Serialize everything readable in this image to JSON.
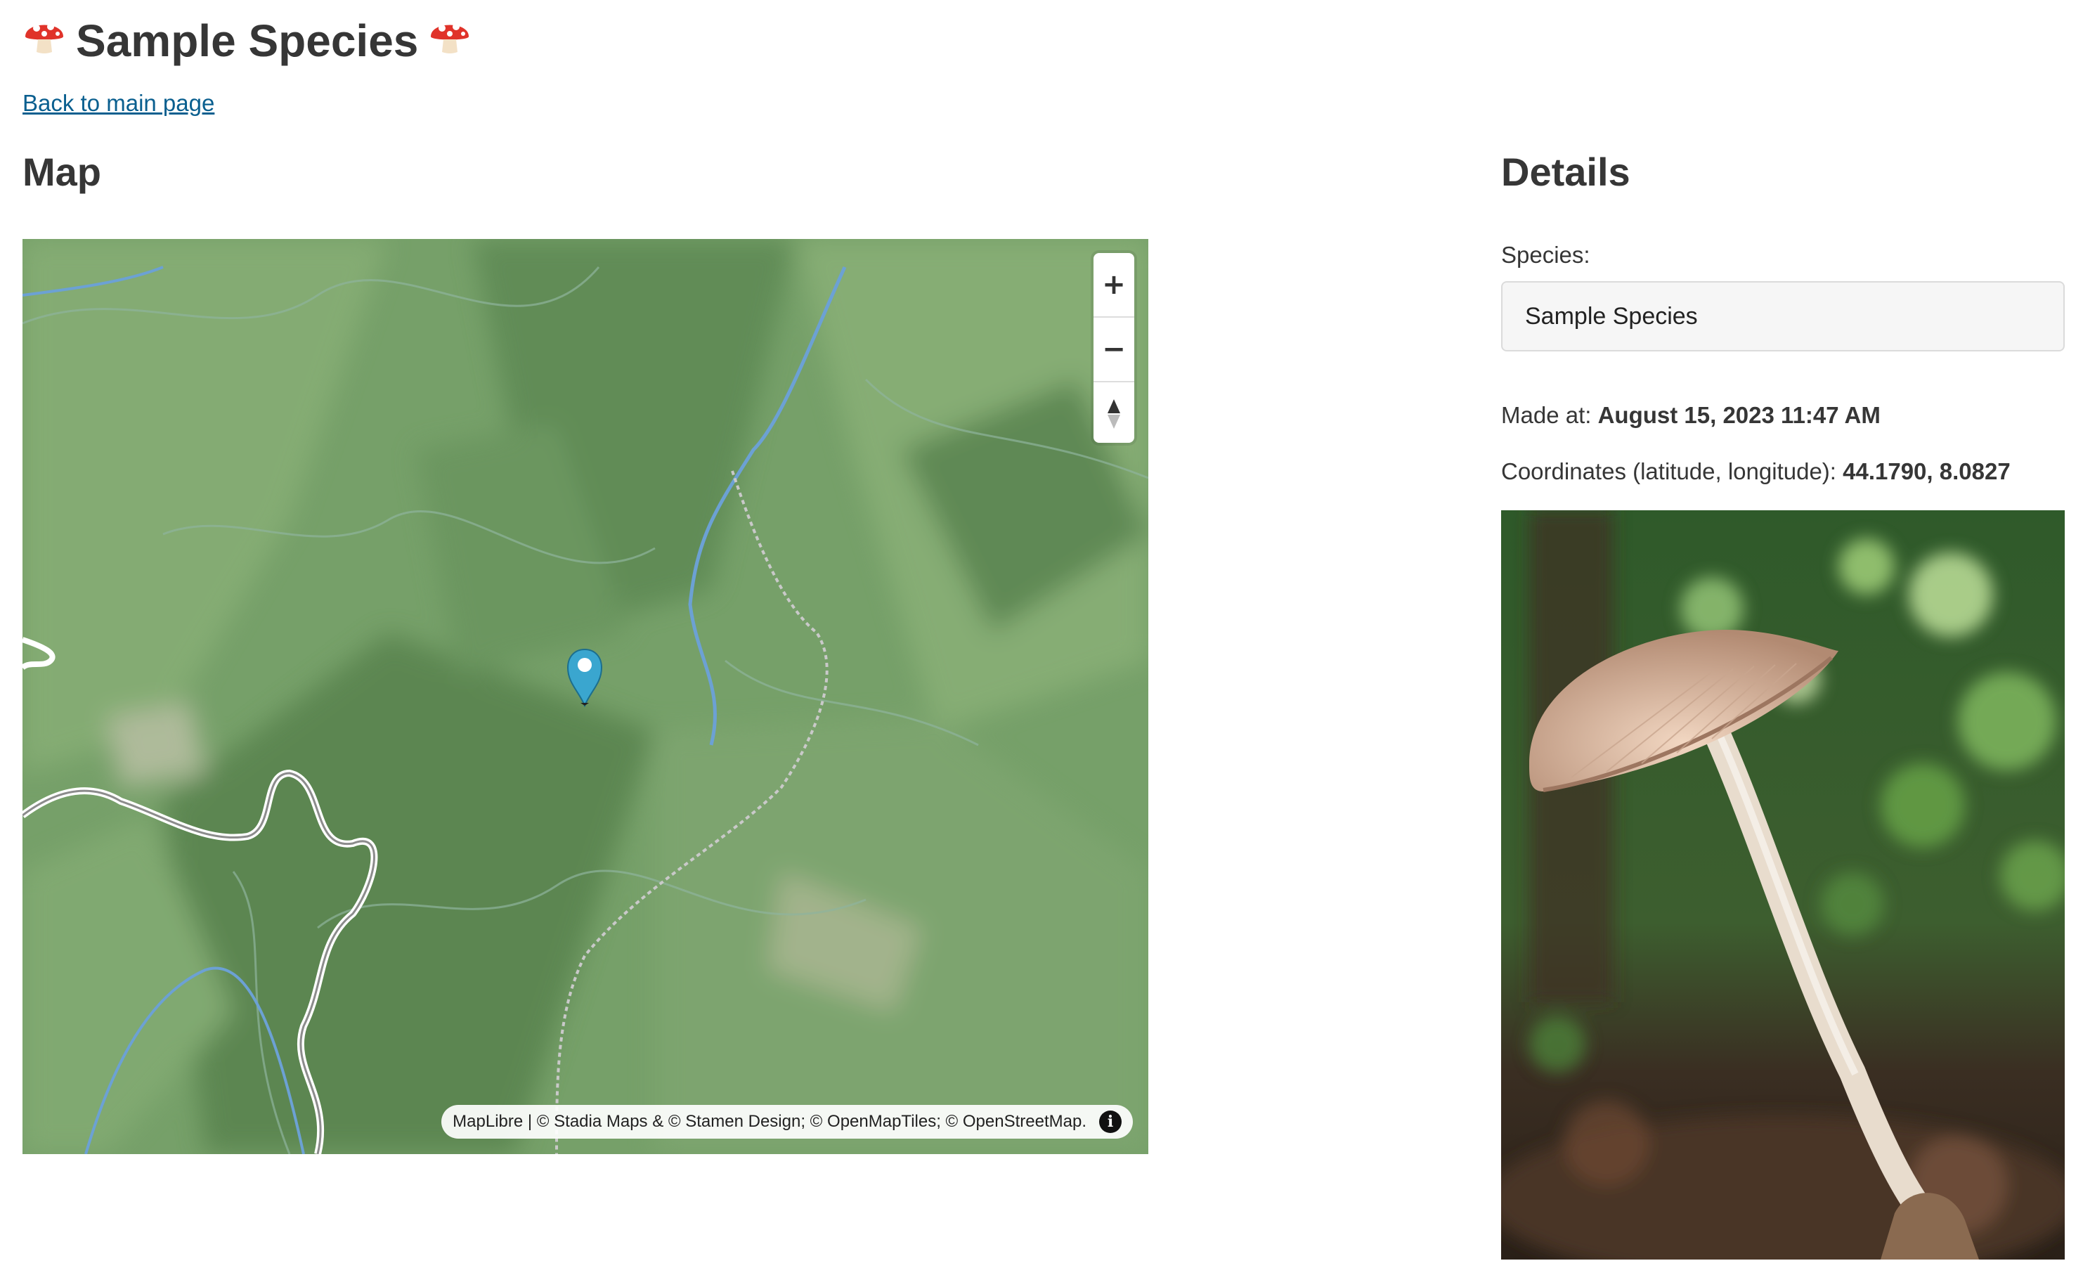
{
  "page": {
    "title": "Sample Species",
    "title_icon": "mushroom-emoji",
    "back_link": "Back to main page"
  },
  "map_section": {
    "heading": "Map",
    "controls": {
      "zoom_in": "+",
      "zoom_out": "−",
      "compass": "north-arrow-icon"
    },
    "marker_icon": "map-pin-icon",
    "attribution": "MapLibre | © Stadia Maps & © Stamen Design; © OpenMapTiles; © OpenStreetMap.",
    "info_icon": "i"
  },
  "details": {
    "heading": "Details",
    "species_label": "Species:",
    "species_value": "Sample Species",
    "made_at_label": "Made at:",
    "made_at_value": "August 15, 2023 11:47 AM",
    "coords_label": "Coordinates (latitude, longitude):",
    "coords_value": "44.1790, 8.0827",
    "photo": "mushroom-photo"
  },
  "colors": {
    "link": "#0a5f8f",
    "map_green": "#6f9a63",
    "marker": "#3aa6cf",
    "text": "#363636"
  }
}
